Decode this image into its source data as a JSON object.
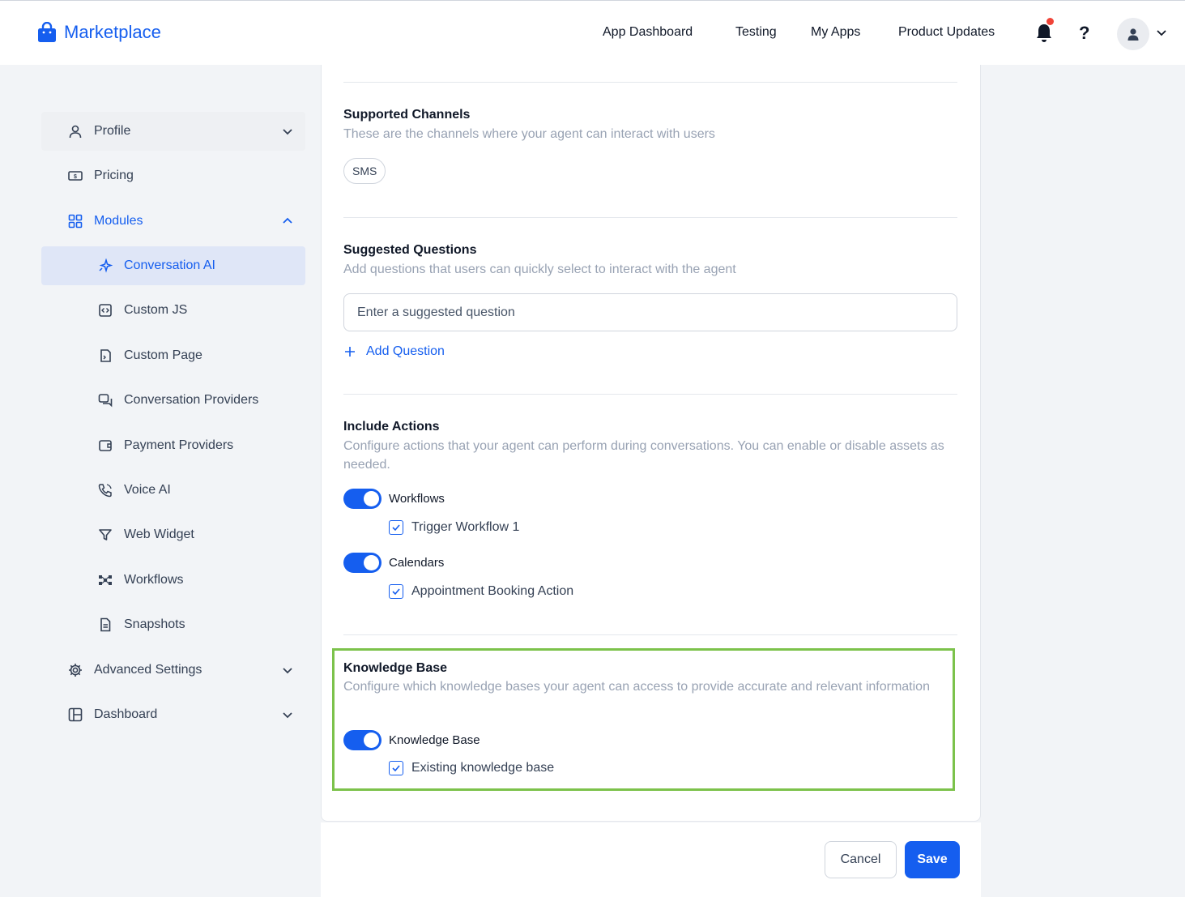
{
  "header": {
    "brand": "Marketplace",
    "nav": [
      "App Dashboard",
      "Testing",
      "My Apps",
      "Product Updates"
    ],
    "help": "?"
  },
  "sidebar": {
    "items": [
      {
        "label": "Profile",
        "icon": "user-icon"
      },
      {
        "label": "Pricing",
        "icon": "money-icon"
      },
      {
        "label": "Modules",
        "icon": "grid-icon"
      },
      {
        "label": "Conversation AI",
        "icon": "sparkle-icon"
      },
      {
        "label": "Custom JS",
        "icon": "code-icon"
      },
      {
        "label": "Custom Page",
        "icon": "page-icon"
      },
      {
        "label": "Conversation Providers",
        "icon": "chat-icon"
      },
      {
        "label": "Payment Providers",
        "icon": "wallet-icon"
      },
      {
        "label": "Voice AI",
        "icon": "phone-icon"
      },
      {
        "label": "Web Widget",
        "icon": "filter-icon"
      },
      {
        "label": "Workflows",
        "icon": "workflow-icon"
      },
      {
        "label": "Snapshots",
        "icon": "document-icon"
      },
      {
        "label": "Advanced Settings",
        "icon": "gear-icon"
      },
      {
        "label": "Dashboard",
        "icon": "layout-icon"
      }
    ]
  },
  "channels": {
    "title": "Supported Channels",
    "desc": "These are the channels where your agent can interact with users",
    "chips": [
      "SMS"
    ]
  },
  "questions": {
    "title": "Suggested Questions",
    "desc": "Add questions that users can quickly select to interact with the agent",
    "placeholder": "Enter a suggested question",
    "add_label": "Add Question"
  },
  "actions": {
    "title": "Include Actions",
    "desc": "Configure actions that your agent can perform during conversations. You can enable or disable assets as needed.",
    "groups": [
      {
        "label": "Workflows",
        "enabled": true,
        "items": [
          "Trigger Workflow 1"
        ]
      },
      {
        "label": "Calendars",
        "enabled": true,
        "items": [
          "Appointment Booking Action"
        ]
      }
    ]
  },
  "knowledge": {
    "title": "Knowledge Base",
    "desc": "Configure which knowledge bases your agent can access to provide accurate and relevant information",
    "toggle_label": "Knowledge Base",
    "enabled": true,
    "items": [
      "Existing knowledge base"
    ]
  },
  "footer": {
    "cancel": "Cancel",
    "save": "Save"
  },
  "colors": {
    "accent": "#155eef",
    "highlight": "#7cc24b",
    "notification": "#f04438"
  }
}
